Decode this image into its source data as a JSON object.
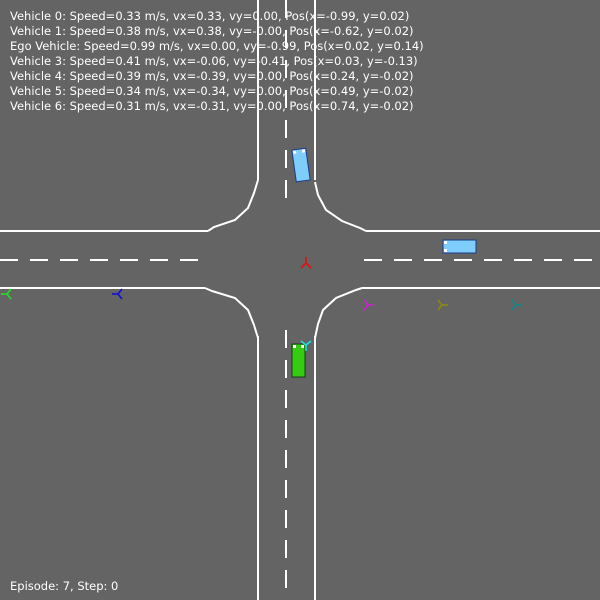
{
  "status_lines": [
    "Vehicle 0: Speed=0.33 m/s, vx=0.33, vy=0.00, Pos(x=-0.99, y=0.02)",
    "Vehicle 1: Speed=0.38 m/s, vx=0.38, vy=-0.00, Pos(x=-0.62, y=0.02)",
    "Ego Vehicle: Speed=0.99 m/s, vx=0.00, vy=-0.99, Pos(x=0.02, y=0.14)",
    "Vehicle 3: Speed=0.41 m/s, vx=-0.06, vy=-0.41, Pos(x=0.03, y=-0.13)",
    "Vehicle 4: Speed=0.39 m/s, vx=-0.39, vy=0.00, Pos(x=0.24, y=-0.02)",
    "Vehicle 5: Speed=0.34 m/s, vx=-0.34, vy=0.00, Pos(x=0.49, y=-0.02)",
    "Vehicle 6: Speed=0.31 m/s, vx=-0.31, vy=0.00, Pos(x=0.74, y=-0.02)"
  ],
  "footer": {
    "text": "Episode: 7, Step: 0"
  },
  "colors": {
    "background": "#646464",
    "lane_marking": "#ffffff",
    "ego_vehicle": "#33cc11",
    "other_vehicle": "#7fcdfa",
    "goal_red": "#e01010",
    "goal_blue": "#1010d0",
    "goal_green": "#22dd22",
    "goal_magenta": "#d020d0",
    "goal_olive": "#8a8a10",
    "goal_teal": "#108a8a",
    "goal_cyan": "#20e0e0"
  },
  "scene": {
    "type": "t-intersection",
    "lanes": 2
  }
}
